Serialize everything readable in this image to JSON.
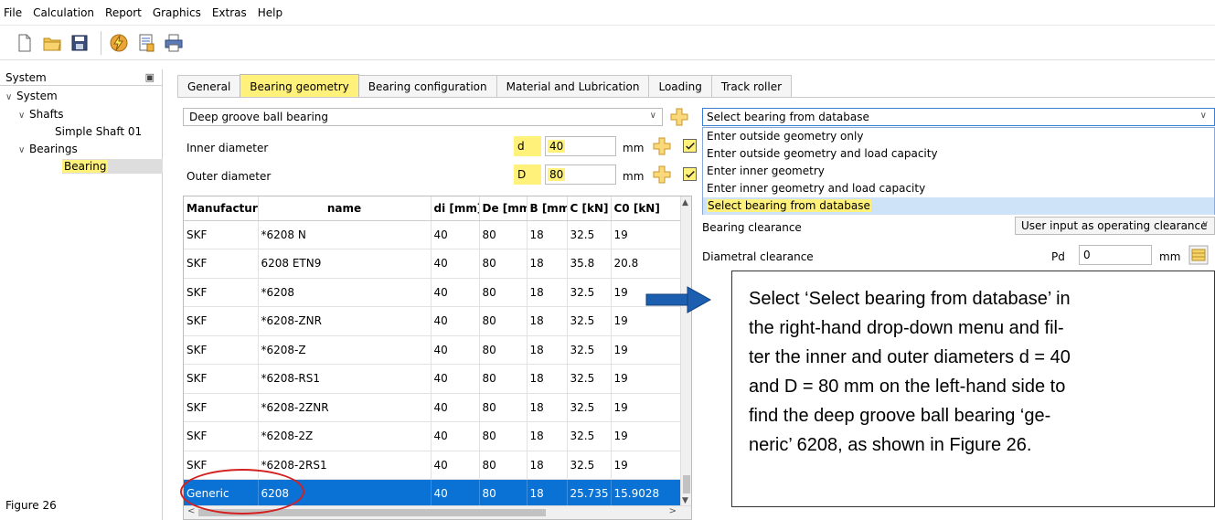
{
  "menu": [
    "File",
    "Calculation",
    "Report",
    "Graphics",
    "Extras",
    "Help"
  ],
  "toolbar": {
    "icons": [
      "new-file-icon",
      "open-folder-icon",
      "save-icon",
      "calculate-lightning-icon",
      "report-icon",
      "print-icon"
    ]
  },
  "system_panel": {
    "title": "System",
    "tree": {
      "root": "System",
      "shafts": "Shafts",
      "shaft_item": "Simple Shaft 01",
      "bearings": "Bearings",
      "bearing_item": "Bearing"
    }
  },
  "figure_caption": "Figure 26",
  "tabs": [
    "General",
    "Bearing geometry",
    "Bearing configuration",
    "Material and Lubrication",
    "Loading",
    "Track roller"
  ],
  "active_tab": "Bearing geometry",
  "bearing_type": "Deep groove ball bearing",
  "inner_diameter": {
    "label": "Inner diameter",
    "symbol": "d",
    "value": "40",
    "unit": "mm"
  },
  "outer_diameter": {
    "label": "Outer diameter",
    "symbol": "D",
    "value": "80",
    "unit": "mm"
  },
  "table": {
    "columns": [
      "Manufacturer",
      "name",
      "di [mm]",
      "De [mm]",
      "B [mm]",
      "C [kN]",
      "C0 [kN]"
    ],
    "rows": [
      [
        "SKF",
        "*6208 N",
        "40",
        "80",
        "18",
        "32.5",
        "19"
      ],
      [
        "SKF",
        "6208 ETN9",
        "40",
        "80",
        "18",
        "35.8",
        "20.8"
      ],
      [
        "SKF",
        "*6208",
        "40",
        "80",
        "18",
        "32.5",
        "19"
      ],
      [
        "SKF",
        "*6208-ZNR",
        "40",
        "80",
        "18",
        "32.5",
        "19"
      ],
      [
        "SKF",
        "*6208-Z",
        "40",
        "80",
        "18",
        "32.5",
        "19"
      ],
      [
        "SKF",
        "*6208-RS1",
        "40",
        "80",
        "18",
        "32.5",
        "19"
      ],
      [
        "SKF",
        "*6208-2ZNR",
        "40",
        "80",
        "18",
        "32.5",
        "19"
      ],
      [
        "SKF",
        "*6208-2Z",
        "40",
        "80",
        "18",
        "32.5",
        "19"
      ],
      [
        "SKF",
        "*6208-2RS1",
        "40",
        "80",
        "18",
        "32.5",
        "19"
      ],
      [
        "Generic",
        "6208",
        "40",
        "80",
        "18",
        "25.735",
        "15.9028"
      ]
    ],
    "selected_row": 9
  },
  "input_mode": {
    "selected": "Select bearing from database",
    "options": [
      "Enter outside geometry only",
      "Enter outside geometry and load capacity",
      "Enter inner geometry",
      "Enter inner geometry and load capacity",
      "Select bearing from database"
    ]
  },
  "bearing_clearance": {
    "label": "Bearing clearance",
    "value": "User input as operating clearance"
  },
  "diametral_clearance": {
    "label": "Diametral clearance",
    "symbol": "Pd",
    "value": "0",
    "unit": "mm"
  },
  "callout": {
    "lines": [
      "Select ‘Select bearing from database’ in",
      "the right-hand drop-down menu and fil-",
      "ter the inner and outer diameters d = 40",
      "and D = 80 mm on the left-hand side to",
      "find the deep groove ball bearing ‘ge-",
      "neric’ 6208, as shown in Figure 26."
    ]
  },
  "colors": {
    "highlight": "#fff17a",
    "selection": "#0a72d4",
    "annotation_circle": "#d42020",
    "arrow": "#1c5fb0"
  }
}
